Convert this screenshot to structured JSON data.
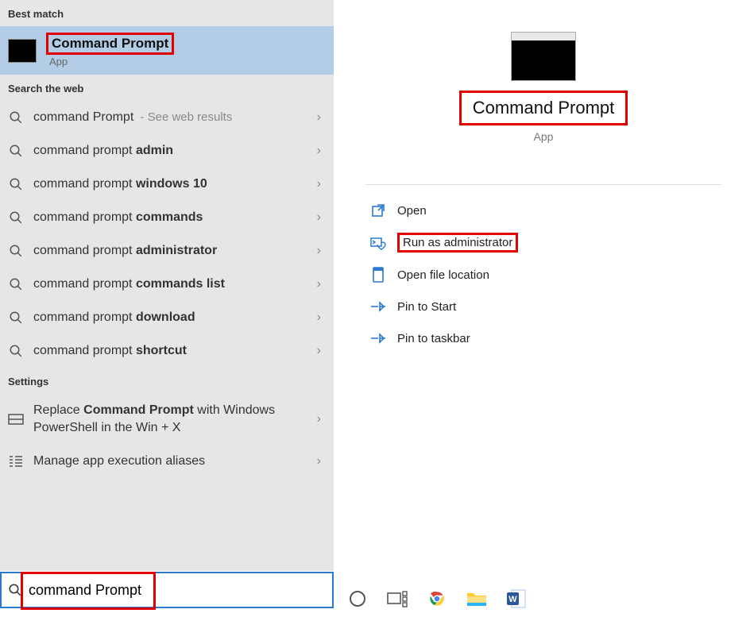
{
  "left": {
    "best_match_header": "Best match",
    "best_match": {
      "title": "Command Prompt",
      "subtitle": "App"
    },
    "web_header": "Search the web",
    "web_results": [
      {
        "prefix": "command Prompt",
        "bold": "",
        "hint": " - See web results"
      },
      {
        "prefix": "command prompt ",
        "bold": "admin",
        "hint": ""
      },
      {
        "prefix": "command prompt ",
        "bold": "windows 10",
        "hint": ""
      },
      {
        "prefix": "command prompt ",
        "bold": "commands",
        "hint": ""
      },
      {
        "prefix": "command prompt ",
        "bold": "administrator",
        "hint": ""
      },
      {
        "prefix": "command prompt ",
        "bold": "commands list",
        "hint": ""
      },
      {
        "prefix": "command prompt ",
        "bold": "download",
        "hint": ""
      },
      {
        "prefix": "command prompt ",
        "bold": "shortcut",
        "hint": ""
      }
    ],
    "settings_header": "Settings",
    "settings": [
      {
        "text_a": "Replace ",
        "bold": "Command Prompt",
        "text_b": " with Windows PowerShell in the Win + X"
      },
      {
        "text_a": "Manage app execution aliases",
        "bold": "",
        "text_b": ""
      }
    ]
  },
  "search_value": "command Prompt",
  "right": {
    "title": "Command Prompt",
    "subtitle": "App",
    "actions": [
      {
        "id": "open",
        "label": "Open"
      },
      {
        "id": "run-admin",
        "label": "Run as administrator"
      },
      {
        "id": "open-location",
        "label": "Open file location"
      },
      {
        "id": "pin-start",
        "label": "Pin to Start"
      },
      {
        "id": "pin-taskbar",
        "label": "Pin to taskbar"
      }
    ]
  },
  "taskbar_icons": [
    "cortana",
    "task-view",
    "chrome",
    "file-explorer",
    "word"
  ]
}
